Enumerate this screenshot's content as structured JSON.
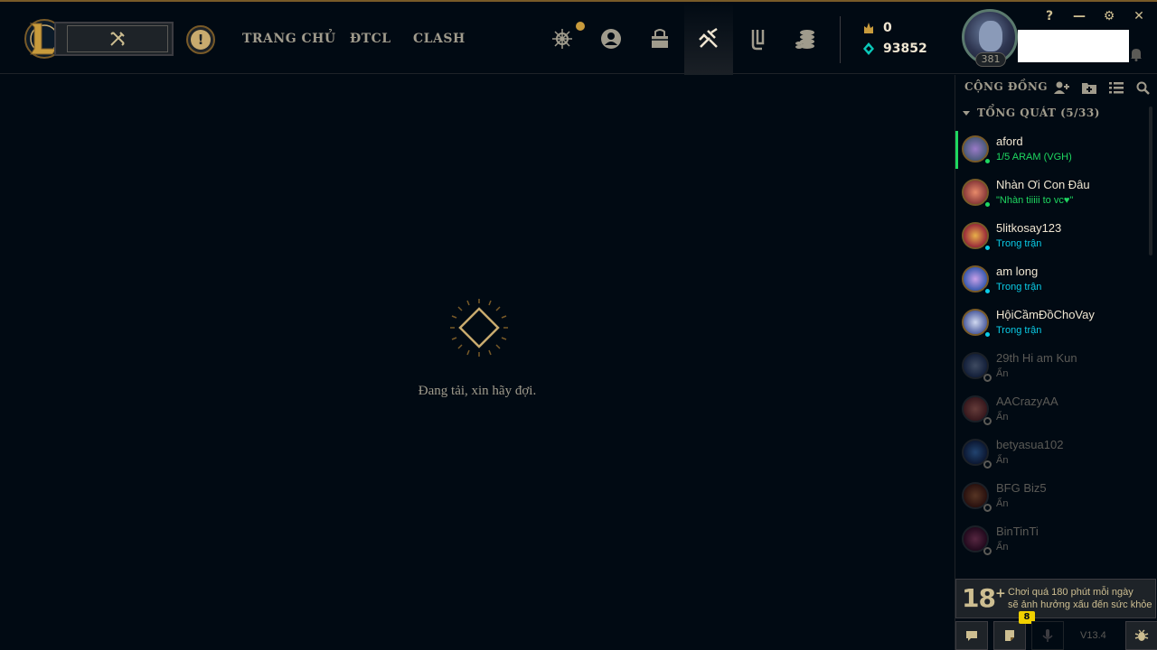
{
  "nav": {
    "links": [
      "TRANG CHỦ",
      "ĐTCL",
      "CLASH"
    ],
    "icons": [
      "crafting-icon",
      "profile-icon",
      "collection-icon",
      "loot-icon",
      "missions-icon",
      "store-icon"
    ]
  },
  "currency": {
    "rp": "0",
    "blue_essence": "93852"
  },
  "profile": {
    "level": "381"
  },
  "window_controls": {
    "help": "?",
    "minimize": "—",
    "settings": "⚙",
    "close": "✕"
  },
  "main": {
    "loading_text": "Đang tải, xin hãy đợi."
  },
  "social": {
    "title": "CỘNG ĐỒNG",
    "group": "TỔNG QUÁT (5/33)",
    "friends": [
      {
        "name": "aford",
        "status": "1/5 ARAM (VGH)"
      },
      {
        "name": "Nhàn Ơi Con Đâu",
        "status": "\"Nhàn tiiiii to vc♥\""
      },
      {
        "name": "5litkosay123",
        "status": "Trong trận"
      },
      {
        "name": "am long",
        "status": "Trong trận"
      },
      {
        "name": "HộiCầmĐồChoVay",
        "status": "Trong trận"
      },
      {
        "name": "29th Hi am Kun",
        "status": "Ẩn"
      },
      {
        "name": "AACrazyAA",
        "status": "Ẩn"
      },
      {
        "name": "betyasua102",
        "status": "Ẩn"
      },
      {
        "name": "BFG Biz5",
        "status": "Ẩn"
      },
      {
        "name": "BinTinTi",
        "status": "Ẩn"
      }
    ]
  },
  "warning": {
    "age": "18",
    "plus": "+",
    "line1": "Chơi quá 180 phút mỗi ngày",
    "line2": "sẽ ảnh hưởng xấu đến sức khỏe"
  },
  "bottom": {
    "badge": "8",
    "version": "V13.4"
  },
  "colors": {
    "gold": "#c8aa6e",
    "background": "#010a13",
    "online_green": "#1ed760",
    "ingame_blue": "#0acbe6",
    "offline_gray": "#5b5a56"
  }
}
